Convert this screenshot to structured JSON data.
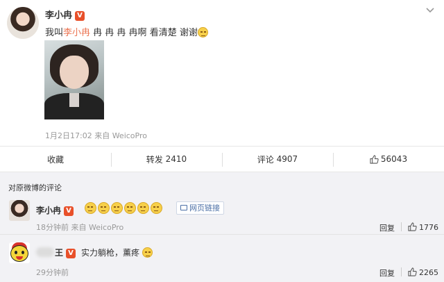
{
  "post": {
    "author": "李小冉",
    "verified_badge": "V",
    "text_prefix": "我叫",
    "text_mention": "李小冉",
    "text_suffix": " 冉 冉 冉 冉啊 看清楚 谢谢",
    "timestamp": "1月2日17:02",
    "source": "来自 WeicoPro",
    "icons": {
      "more": "chevron-down-icon",
      "emoji": "tear-emoji-icon"
    },
    "colors": {
      "mention": "#eb7350",
      "badge": "#e8502a"
    }
  },
  "actions": {
    "favorite": "收藏",
    "repost_label": "转发",
    "repost_count": "2410",
    "comment_label": "评论",
    "comment_count": "4907",
    "like_count": "56043"
  },
  "comments_section": {
    "header": "对原微博的评论",
    "items": [
      {
        "name": "李小冉",
        "badge": "V",
        "emoji_count": 6,
        "link_label": "网页链接",
        "time": "18分钟前",
        "source": "来自 WeicoPro",
        "reply": "回复",
        "likes": "1776"
      },
      {
        "name_visible": "王",
        "badge": "V",
        "text": "实力躺枪，薰疼",
        "time": "29分钟前",
        "reply": "回复",
        "likes": "2265"
      }
    ]
  }
}
